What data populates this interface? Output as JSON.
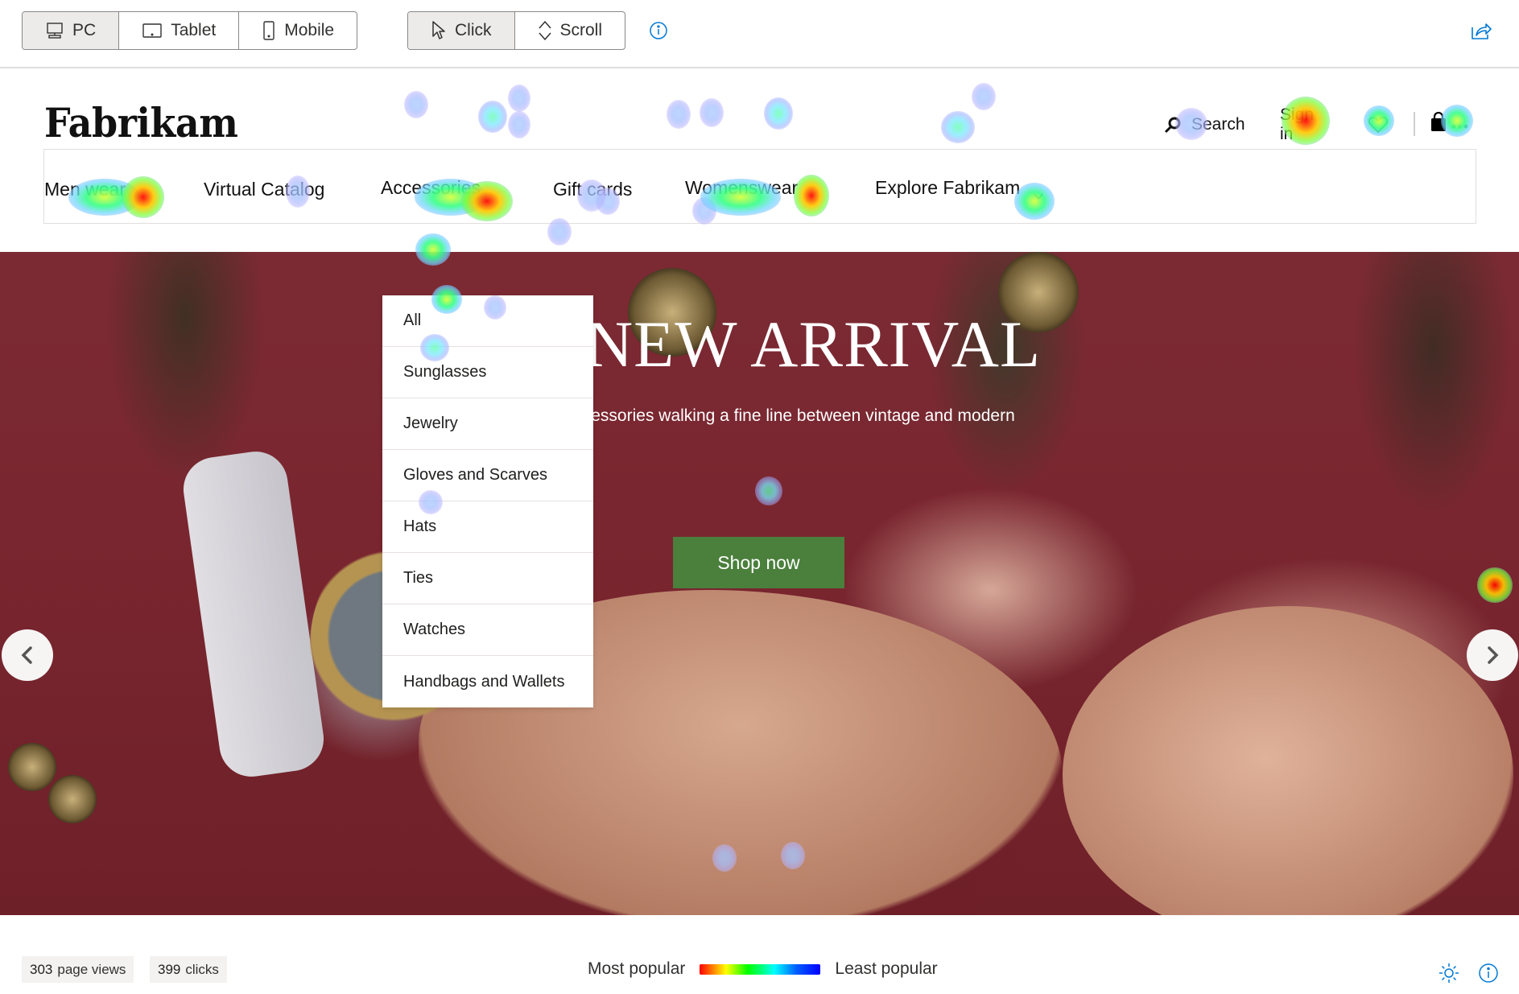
{
  "toolbar": {
    "device_options": [
      {
        "label": "PC",
        "icon": "monitor-icon",
        "active": true
      },
      {
        "label": "Tablet",
        "icon": "tablet-icon",
        "active": false
      },
      {
        "label": "Mobile",
        "icon": "mobile-icon",
        "active": false
      }
    ],
    "mode_options": [
      {
        "label": "Click",
        "icon": "cursor-icon",
        "active": true
      },
      {
        "label": "Scroll",
        "icon": "scroll-icon",
        "active": false
      }
    ],
    "info_icon": "info-icon",
    "share_icon": "share-icon"
  },
  "site": {
    "logo": "Fabrikam",
    "header": {
      "search_label": "Search",
      "signin_label": "Sign in",
      "wishlist_icon": "heart-icon",
      "cart_icon": "shopping-bag-icon",
      "more_label": "•••"
    },
    "nav": [
      {
        "label": "Men wear"
      },
      {
        "label": "Virtual Catalog"
      },
      {
        "label": "Accessories"
      },
      {
        "label": "Gift cards"
      },
      {
        "label": "Womenswear"
      },
      {
        "label": "Explore Fabrikam",
        "has_chevron": true
      }
    ],
    "dropdown": {
      "parent": "Accessories",
      "items": [
        "All",
        "Sunglasses",
        "Jewelry",
        "Gloves and Scarves",
        "Hats",
        "Ties",
        "Watches",
        "Handbags and Wallets"
      ]
    },
    "hero": {
      "title": "NEW ARRIVAL",
      "subtitle": "Accessories walking a fine line between vintage and modern",
      "cta_label": "Shop now",
      "slide_count": 3,
      "active_slide": 2
    }
  },
  "footer": {
    "page_views_count": "303",
    "page_views_label": "page views",
    "clicks_count": "399",
    "clicks_label": "clicks",
    "legend_most": "Most popular",
    "legend_least": "Least popular",
    "legend_colors": [
      "#ff0000",
      "#ffff00",
      "#00ff00",
      "#00ffff",
      "#0000ff"
    ],
    "brightness_icon": "sun-icon",
    "info_icon": "info-icon"
  },
  "colors": {
    "accent_blue": "#0078d4",
    "cta_green": "#4a7f3c",
    "hero_maroon": "#7a2630"
  }
}
